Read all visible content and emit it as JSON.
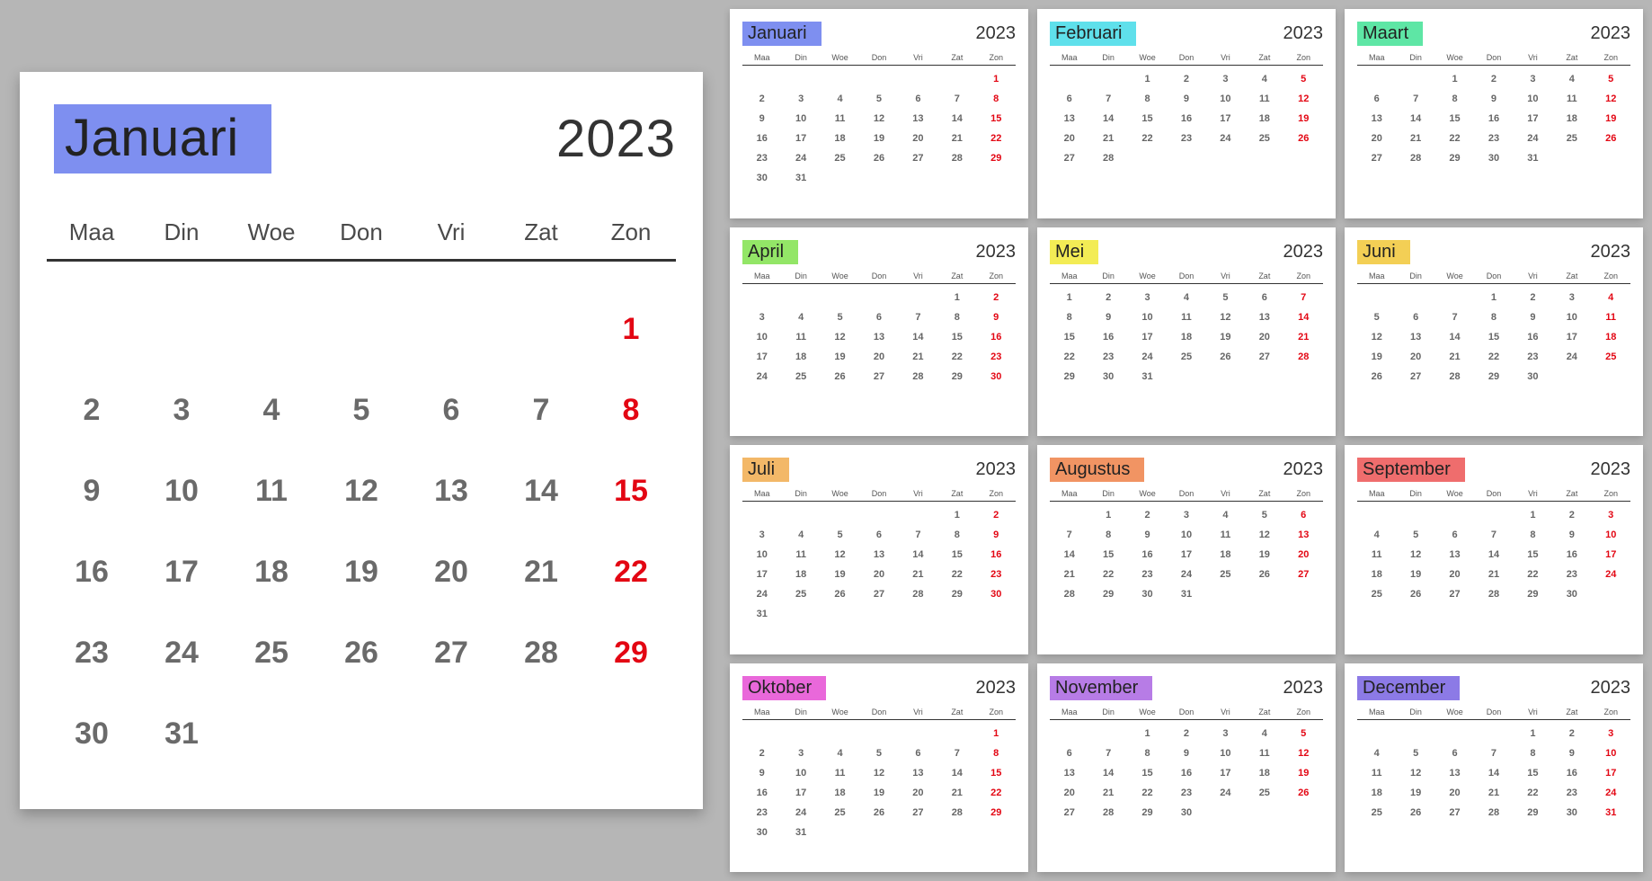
{
  "year": "2023",
  "weekdays": [
    "Maa",
    "Din",
    "Woe",
    "Don",
    "Vri",
    "Zat",
    "Zon"
  ],
  "featured": {
    "name": "Januari",
    "color": "#7e8ff0",
    "weeks": [
      [
        "",
        "",
        "",
        "",
        "",
        "",
        "1"
      ],
      [
        "2",
        "3",
        "4",
        "5",
        "6",
        "7",
        "8"
      ],
      [
        "9",
        "10",
        "11",
        "12",
        "13",
        "14",
        "15"
      ],
      [
        "16",
        "17",
        "18",
        "19",
        "20",
        "21",
        "22"
      ],
      [
        "23",
        "24",
        "25",
        "26",
        "27",
        "28",
        "29"
      ],
      [
        "30",
        "31",
        "",
        "",
        "",
        "",
        ""
      ]
    ]
  },
  "months": [
    {
      "name": "Januari",
      "color": "#7e8ff0",
      "weeks": [
        [
          "",
          "",
          "",
          "",
          "",
          "",
          "1"
        ],
        [
          "2",
          "3",
          "4",
          "5",
          "6",
          "7",
          "8"
        ],
        [
          "9",
          "10",
          "11",
          "12",
          "13",
          "14",
          "15"
        ],
        [
          "16",
          "17",
          "18",
          "19",
          "20",
          "21",
          "22"
        ],
        [
          "23",
          "24",
          "25",
          "26",
          "27",
          "28",
          "29"
        ],
        [
          "30",
          "31",
          "",
          "",
          "",
          "",
          ""
        ]
      ]
    },
    {
      "name": "Februari",
      "color": "#5fe0eb",
      "weeks": [
        [
          "",
          "",
          "1",
          "2",
          "3",
          "4",
          "5"
        ],
        [
          "6",
          "7",
          "8",
          "9",
          "10",
          "11",
          "12"
        ],
        [
          "13",
          "14",
          "15",
          "16",
          "17",
          "18",
          "19"
        ],
        [
          "20",
          "21",
          "22",
          "23",
          "24",
          "25",
          "26"
        ],
        [
          "27",
          "28",
          "",
          "",
          "",
          "",
          ""
        ]
      ]
    },
    {
      "name": "Maart",
      "color": "#5ee6a5",
      "weeks": [
        [
          "",
          "",
          "1",
          "2",
          "3",
          "4",
          "5"
        ],
        [
          "6",
          "7",
          "8",
          "9",
          "10",
          "11",
          "12"
        ],
        [
          "13",
          "14",
          "15",
          "16",
          "17",
          "18",
          "19"
        ],
        [
          "20",
          "21",
          "22",
          "23",
          "24",
          "25",
          "26"
        ],
        [
          "27",
          "28",
          "29",
          "30",
          "31",
          "",
          ""
        ]
      ]
    },
    {
      "name": "April",
      "color": "#93e667",
      "weeks": [
        [
          "",
          "",
          "",
          "",
          "",
          "1",
          "2"
        ],
        [
          "3",
          "4",
          "5",
          "6",
          "7",
          "8",
          "9"
        ],
        [
          "10",
          "11",
          "12",
          "13",
          "14",
          "15",
          "16"
        ],
        [
          "17",
          "18",
          "19",
          "20",
          "21",
          "22",
          "23"
        ],
        [
          "24",
          "25",
          "26",
          "27",
          "28",
          "29",
          "30"
        ]
      ]
    },
    {
      "name": "Mei",
      "color": "#f3ec55",
      "weeks": [
        [
          "1",
          "2",
          "3",
          "4",
          "5",
          "6",
          "7"
        ],
        [
          "8",
          "9",
          "10",
          "11",
          "12",
          "13",
          "14"
        ],
        [
          "15",
          "16",
          "17",
          "18",
          "19",
          "20",
          "21"
        ],
        [
          "22",
          "23",
          "24",
          "25",
          "26",
          "27",
          "28"
        ],
        [
          "29",
          "30",
          "31",
          "",
          "",
          "",
          ""
        ]
      ]
    },
    {
      "name": "Juni",
      "color": "#f3cf55",
      "weeks": [
        [
          "",
          "",
          "",
          "1",
          "2",
          "3",
          "4"
        ],
        [
          "5",
          "6",
          "7",
          "8",
          "9",
          "10",
          "11"
        ],
        [
          "12",
          "13",
          "14",
          "15",
          "16",
          "17",
          "18"
        ],
        [
          "19",
          "20",
          "21",
          "22",
          "23",
          "24",
          "25"
        ],
        [
          "26",
          "27",
          "28",
          "29",
          "30",
          "",
          ""
        ]
      ]
    },
    {
      "name": "Juli",
      "color": "#f3b868",
      "weeks": [
        [
          "",
          "",
          "",
          "",
          "",
          "1",
          "2"
        ],
        [
          "3",
          "4",
          "5",
          "6",
          "7",
          "8",
          "9"
        ],
        [
          "10",
          "11",
          "12",
          "13",
          "14",
          "15",
          "16"
        ],
        [
          "17",
          "18",
          "19",
          "20",
          "21",
          "22",
          "23"
        ],
        [
          "24",
          "25",
          "26",
          "27",
          "28",
          "29",
          "30"
        ],
        [
          "31",
          "",
          "",
          "",
          "",
          "",
          ""
        ]
      ]
    },
    {
      "name": "Augustus",
      "color": "#f19463",
      "weeks": [
        [
          "",
          "1",
          "2",
          "3",
          "4",
          "5",
          "6"
        ],
        [
          "7",
          "8",
          "9",
          "10",
          "11",
          "12",
          "13"
        ],
        [
          "14",
          "15",
          "16",
          "17",
          "18",
          "19",
          "20"
        ],
        [
          "21",
          "22",
          "23",
          "24",
          "25",
          "26",
          "27"
        ],
        [
          "28",
          "29",
          "30",
          "31",
          "",
          "",
          ""
        ]
      ]
    },
    {
      "name": "September",
      "color": "#ef6d6d",
      "weeks": [
        [
          "",
          "",
          "",
          "",
          "1",
          "2",
          "3"
        ],
        [
          "4",
          "5",
          "6",
          "7",
          "8",
          "9",
          "10"
        ],
        [
          "11",
          "12",
          "13",
          "14",
          "15",
          "16",
          "17"
        ],
        [
          "18",
          "19",
          "20",
          "21",
          "22",
          "23",
          "24"
        ],
        [
          "25",
          "26",
          "27",
          "28",
          "29",
          "30",
          ""
        ]
      ]
    },
    {
      "name": "Oktober",
      "color": "#e968da",
      "weeks": [
        [
          "",
          "",
          "",
          "",
          "",
          "",
          "1"
        ],
        [
          "2",
          "3",
          "4",
          "5",
          "6",
          "7",
          "8"
        ],
        [
          "9",
          "10",
          "11",
          "12",
          "13",
          "14",
          "15"
        ],
        [
          "16",
          "17",
          "18",
          "19",
          "20",
          "21",
          "22"
        ],
        [
          "23",
          "24",
          "25",
          "26",
          "27",
          "28",
          "29"
        ],
        [
          "30",
          "31",
          "",
          "",
          "",
          "",
          ""
        ]
      ]
    },
    {
      "name": "November",
      "color": "#b77ce6",
      "weeks": [
        [
          "",
          "",
          "1",
          "2",
          "3",
          "4",
          "5"
        ],
        [
          "6",
          "7",
          "8",
          "9",
          "10",
          "11",
          "12"
        ],
        [
          "13",
          "14",
          "15",
          "16",
          "17",
          "18",
          "19"
        ],
        [
          "20",
          "21",
          "22",
          "23",
          "24",
          "25",
          "26"
        ],
        [
          "27",
          "28",
          "29",
          "30",
          "",
          "",
          ""
        ]
      ]
    },
    {
      "name": "December",
      "color": "#8c7ae6",
      "weeks": [
        [
          "",
          "",
          "",
          "",
          "1",
          "2",
          "3"
        ],
        [
          "4",
          "5",
          "6",
          "7",
          "8",
          "9",
          "10"
        ],
        [
          "11",
          "12",
          "13",
          "14",
          "15",
          "16",
          "17"
        ],
        [
          "18",
          "19",
          "20",
          "21",
          "22",
          "23",
          "24"
        ],
        [
          "25",
          "26",
          "27",
          "28",
          "29",
          "30",
          "31"
        ]
      ]
    }
  ]
}
